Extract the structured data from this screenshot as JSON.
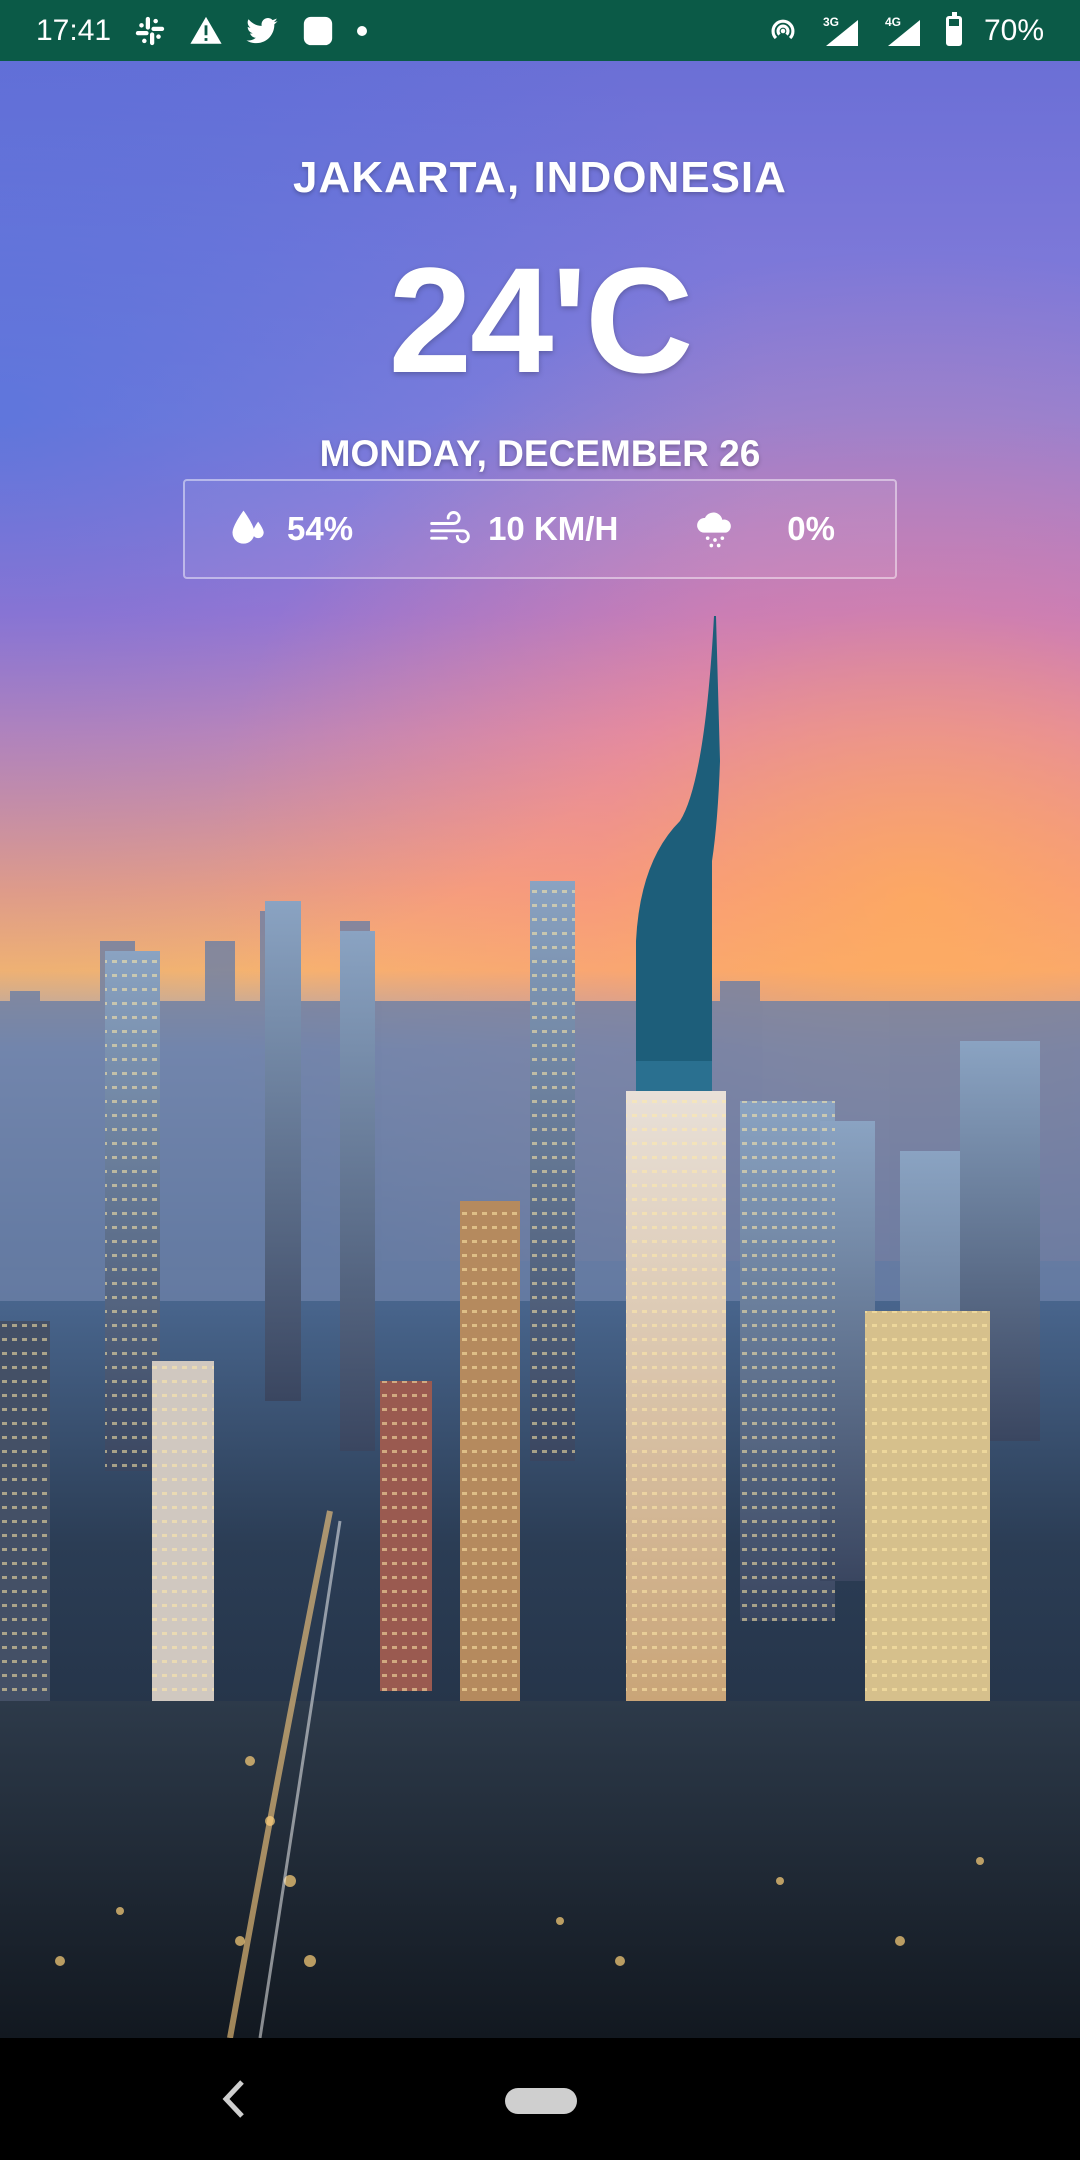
{
  "status_bar": {
    "time": "17:41",
    "left_icons": [
      "slack-icon",
      "warning-icon",
      "twitter-icon",
      "app-square-icon",
      "dot-icon"
    ],
    "right_icons": [
      "hotspot-icon",
      "signal-3g-icon",
      "signal-4g-icon",
      "battery-icon"
    ],
    "signal_3g": "3G",
    "signal_4g": "4G",
    "battery": "70%",
    "battery_level": 0.7,
    "color": "#0b5a47"
  },
  "weather": {
    "location": "JAKARTA, INDONESIA",
    "temperature": "24'C",
    "date": "MONDAY, DECEMBER 26",
    "humidity": "54%",
    "wind": "10 KM/H",
    "precipitation": "0%"
  },
  "nav_bar": {
    "back_icon": "chevron-left-icon",
    "home_icon": "home-pill-icon"
  }
}
